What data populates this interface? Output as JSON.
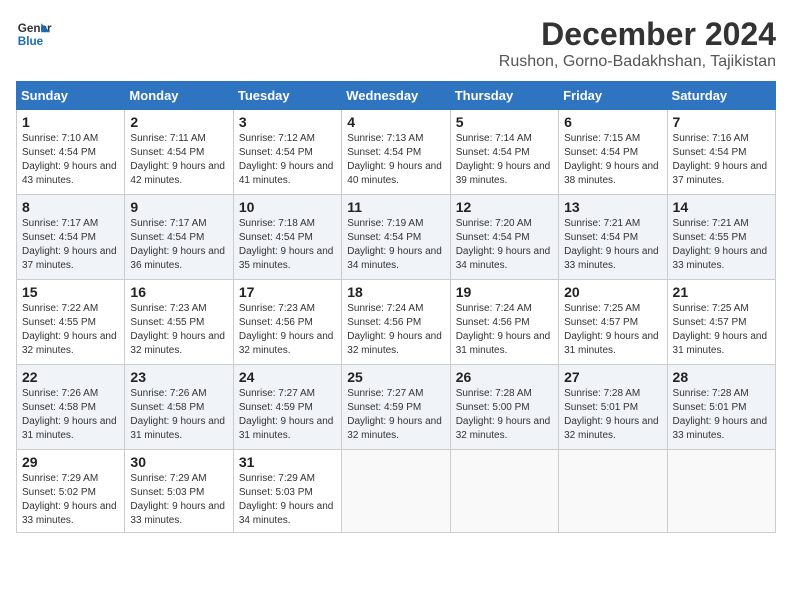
{
  "logo": {
    "line1": "General",
    "line2": "Blue"
  },
  "title": "December 2024",
  "subtitle": "Rushon, Gorno-Badakhshan, Tajikistan",
  "weekdays": [
    "Sunday",
    "Monday",
    "Tuesday",
    "Wednesday",
    "Thursday",
    "Friday",
    "Saturday"
  ],
  "weeks": [
    [
      {
        "day": "1",
        "sunrise": "7:10 AM",
        "sunset": "4:54 PM",
        "daylight": "9 hours and 43 minutes."
      },
      {
        "day": "2",
        "sunrise": "7:11 AM",
        "sunset": "4:54 PM",
        "daylight": "9 hours and 42 minutes."
      },
      {
        "day": "3",
        "sunrise": "7:12 AM",
        "sunset": "4:54 PM",
        "daylight": "9 hours and 41 minutes."
      },
      {
        "day": "4",
        "sunrise": "7:13 AM",
        "sunset": "4:54 PM",
        "daylight": "9 hours and 40 minutes."
      },
      {
        "day": "5",
        "sunrise": "7:14 AM",
        "sunset": "4:54 PM",
        "daylight": "9 hours and 39 minutes."
      },
      {
        "day": "6",
        "sunrise": "7:15 AM",
        "sunset": "4:54 PM",
        "daylight": "9 hours and 38 minutes."
      },
      {
        "day": "7",
        "sunrise": "7:16 AM",
        "sunset": "4:54 PM",
        "daylight": "9 hours and 37 minutes."
      }
    ],
    [
      {
        "day": "8",
        "sunrise": "7:17 AM",
        "sunset": "4:54 PM",
        "daylight": "9 hours and 37 minutes."
      },
      {
        "day": "9",
        "sunrise": "7:17 AM",
        "sunset": "4:54 PM",
        "daylight": "9 hours and 36 minutes."
      },
      {
        "day": "10",
        "sunrise": "7:18 AM",
        "sunset": "4:54 PM",
        "daylight": "9 hours and 35 minutes."
      },
      {
        "day": "11",
        "sunrise": "7:19 AM",
        "sunset": "4:54 PM",
        "daylight": "9 hours and 34 minutes."
      },
      {
        "day": "12",
        "sunrise": "7:20 AM",
        "sunset": "4:54 PM",
        "daylight": "9 hours and 34 minutes."
      },
      {
        "day": "13",
        "sunrise": "7:21 AM",
        "sunset": "4:54 PM",
        "daylight": "9 hours and 33 minutes."
      },
      {
        "day": "14",
        "sunrise": "7:21 AM",
        "sunset": "4:55 PM",
        "daylight": "9 hours and 33 minutes."
      }
    ],
    [
      {
        "day": "15",
        "sunrise": "7:22 AM",
        "sunset": "4:55 PM",
        "daylight": "9 hours and 32 minutes."
      },
      {
        "day": "16",
        "sunrise": "7:23 AM",
        "sunset": "4:55 PM",
        "daylight": "9 hours and 32 minutes."
      },
      {
        "day": "17",
        "sunrise": "7:23 AM",
        "sunset": "4:56 PM",
        "daylight": "9 hours and 32 minutes."
      },
      {
        "day": "18",
        "sunrise": "7:24 AM",
        "sunset": "4:56 PM",
        "daylight": "9 hours and 32 minutes."
      },
      {
        "day": "19",
        "sunrise": "7:24 AM",
        "sunset": "4:56 PM",
        "daylight": "9 hours and 31 minutes."
      },
      {
        "day": "20",
        "sunrise": "7:25 AM",
        "sunset": "4:57 PM",
        "daylight": "9 hours and 31 minutes."
      },
      {
        "day": "21",
        "sunrise": "7:25 AM",
        "sunset": "4:57 PM",
        "daylight": "9 hours and 31 minutes."
      }
    ],
    [
      {
        "day": "22",
        "sunrise": "7:26 AM",
        "sunset": "4:58 PM",
        "daylight": "9 hours and 31 minutes."
      },
      {
        "day": "23",
        "sunrise": "7:26 AM",
        "sunset": "4:58 PM",
        "daylight": "9 hours and 31 minutes."
      },
      {
        "day": "24",
        "sunrise": "7:27 AM",
        "sunset": "4:59 PM",
        "daylight": "9 hours and 31 minutes."
      },
      {
        "day": "25",
        "sunrise": "7:27 AM",
        "sunset": "4:59 PM",
        "daylight": "9 hours and 32 minutes."
      },
      {
        "day": "26",
        "sunrise": "7:28 AM",
        "sunset": "5:00 PM",
        "daylight": "9 hours and 32 minutes."
      },
      {
        "day": "27",
        "sunrise": "7:28 AM",
        "sunset": "5:01 PM",
        "daylight": "9 hours and 32 minutes."
      },
      {
        "day": "28",
        "sunrise": "7:28 AM",
        "sunset": "5:01 PM",
        "daylight": "9 hours and 33 minutes."
      }
    ],
    [
      {
        "day": "29",
        "sunrise": "7:29 AM",
        "sunset": "5:02 PM",
        "daylight": "9 hours and 33 minutes."
      },
      {
        "day": "30",
        "sunrise": "7:29 AM",
        "sunset": "5:03 PM",
        "daylight": "9 hours and 33 minutes."
      },
      {
        "day": "31",
        "sunrise": "7:29 AM",
        "sunset": "5:03 PM",
        "daylight": "9 hours and 34 minutes."
      },
      null,
      null,
      null,
      null
    ]
  ]
}
